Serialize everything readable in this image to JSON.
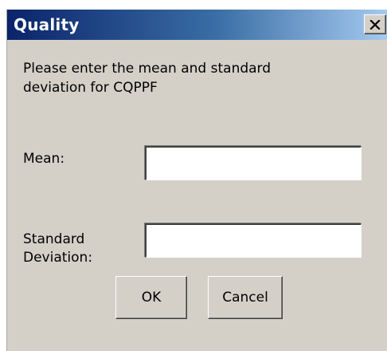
{
  "window": {
    "title": "Quality",
    "close_icon": "close-x",
    "titlebar_color_start": "#0a246a",
    "titlebar_color_end": "#a6caf0",
    "background_color": "#d4d0c8"
  },
  "prompt": {
    "line1": "Please enter the mean and standard",
    "line2": "deviation for CQPPF"
  },
  "fields": {
    "mean": {
      "label": "Mean:",
      "value": "",
      "placeholder": ""
    },
    "standard_deviation": {
      "label_line1": "Standard",
      "label_line2": "Deviation:",
      "value": "",
      "placeholder": ""
    }
  },
  "buttons": {
    "ok_label": "OK",
    "cancel_label": "Cancel"
  }
}
